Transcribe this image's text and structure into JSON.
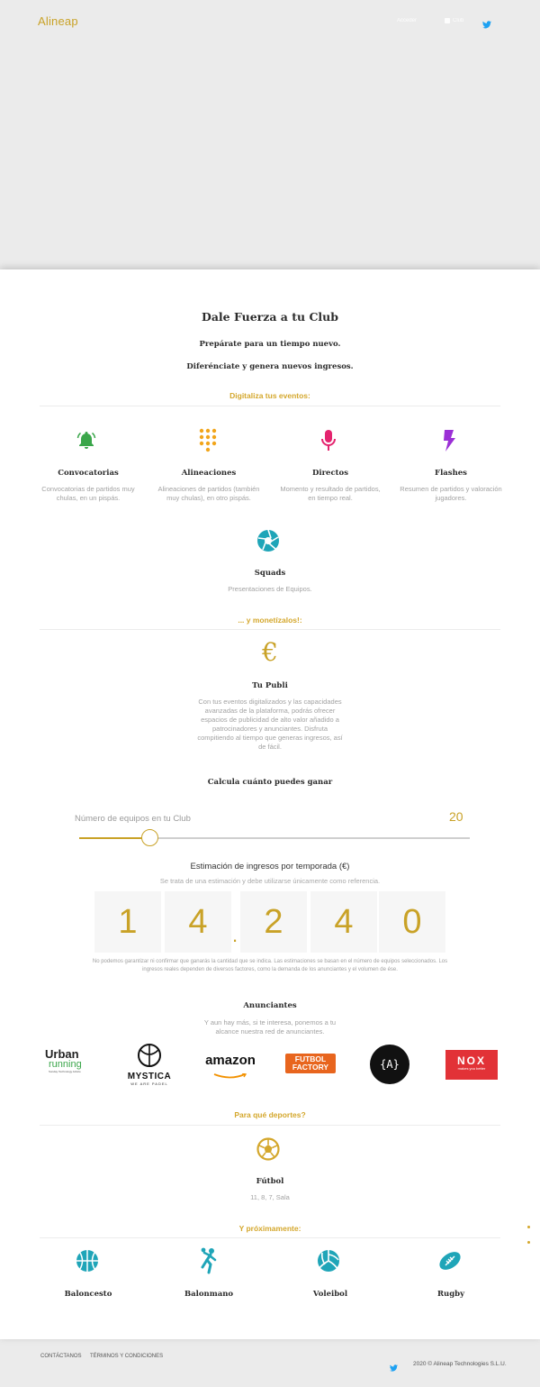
{
  "nav": {
    "brand": "Alineap",
    "login": "Acceder",
    "cart": "Club",
    "twitter_icon": "twitter-icon"
  },
  "intro": {
    "title": "Dale Fuerza a tu Club",
    "line1": "Prepárate para un tiempo nuevo.",
    "line2": "Diferénciate y genera nuevos ingresos."
  },
  "digitalize": {
    "heading": "Digitaliza tus eventos:",
    "features": [
      {
        "title": "Convocatorias",
        "desc1": "Convocatorias de partidos muy",
        "desc2": "chulas, en un pispás.",
        "icon": "bell-icon",
        "color": "#3aa64a"
      },
      {
        "title": "Alineaciones",
        "desc1": "Alineaciones de partidos (también",
        "desc2": "muy chulas), en otro pispás.",
        "icon": "dialpad-icon",
        "color": "#f2a51a"
      },
      {
        "title": "Directos",
        "desc1": "Momento y resultado de partidos,",
        "desc2": "en tiempo real.",
        "icon": "microphone-icon",
        "color": "#e4236e"
      },
      {
        "title": "Flashes",
        "desc1": "Resumen de partidos y valoración",
        "desc2": "jugadores.",
        "icon": "flash-icon",
        "color": "#9b2fd6"
      }
    ],
    "squads": {
      "title": "Squads",
      "desc": "Presentaciones de Equipos.",
      "icon": "camera-aperture-icon",
      "color": "#1fa5b8"
    }
  },
  "monetize": {
    "heading": "... y monetízalos!:",
    "title": "Tu Publi",
    "icon": "euro-icon",
    "desc": [
      "Con tus eventos digitalizados y las capacidades",
      "avanzadas de la plataforma, podrás ofrecer",
      "espacios de publicidad de alto valor añadido a",
      "patrocinadores y anunciantes. Disfruta",
      "compitiendo al tiempo que generas ingresos, así",
      "de fácil."
    ]
  },
  "calculator": {
    "title": "Calcula cuánto puedes ganar",
    "label": "Número de equipos en tu Club",
    "value": "20",
    "slider_fraction": 0.18,
    "estimate_title": "Estimación de ingresos por temporada (€)",
    "estimate_sub": "Se trata de una estimación y debe utilizarse únicamente como referencia.",
    "digits": [
      "1",
      "4",
      "2",
      "4",
      "0"
    ],
    "separator": ".",
    "disclaimer1": "No podemos garantizar ni confirmar que ganarás la cantidad que se indica. Las estimaciones se basan en el número de equipos seleccionados. Los",
    "disclaimer2": "ingresos reales dependen de diversos factores, como la demanda de los anunciantes y el volumen de ése."
  },
  "advertisers": {
    "title": "Anunciantes",
    "desc1": "Y aun hay más, si te interesa, ponemos a tu",
    "desc2": "alcance nuestra red de anunciantes.",
    "logos": {
      "urban1": "Urban",
      "urban2": "running",
      "urban3": "Sunday Technology Advice",
      "mystica": "MYSTICA",
      "mystica_sub": "WE ARE PADEL",
      "amazon": "amazon",
      "futbol1": "FUTBOL",
      "futbol2": "FACTORY",
      "a_logo": "{A}",
      "nox": "NOX",
      "nox_sub": "makes you better"
    }
  },
  "sports": {
    "heading": "Para qué deportes?",
    "title": "Fútbol",
    "desc": "11, 8, 7, Sala",
    "icon": "soccer-ball-icon"
  },
  "coming": {
    "heading": "Y próximamente:",
    "items": [
      {
        "title": "Baloncesto",
        "icon": "basketball-icon"
      },
      {
        "title": "Balonmano",
        "icon": "handball-icon"
      },
      {
        "title": "Voleibol",
        "icon": "volleyball-icon"
      },
      {
        "title": "Rugby",
        "icon": "rugby-ball-icon"
      }
    ]
  },
  "footer": {
    "contact": "CONTÁCTANOS",
    "terms": "TÉRMINOS Y CONDICIONES",
    "copyright": "2020 © Alineap Technologies S.L.U."
  },
  "colors": {
    "accent": "#c9a227",
    "teal": "#1fa5b8"
  }
}
